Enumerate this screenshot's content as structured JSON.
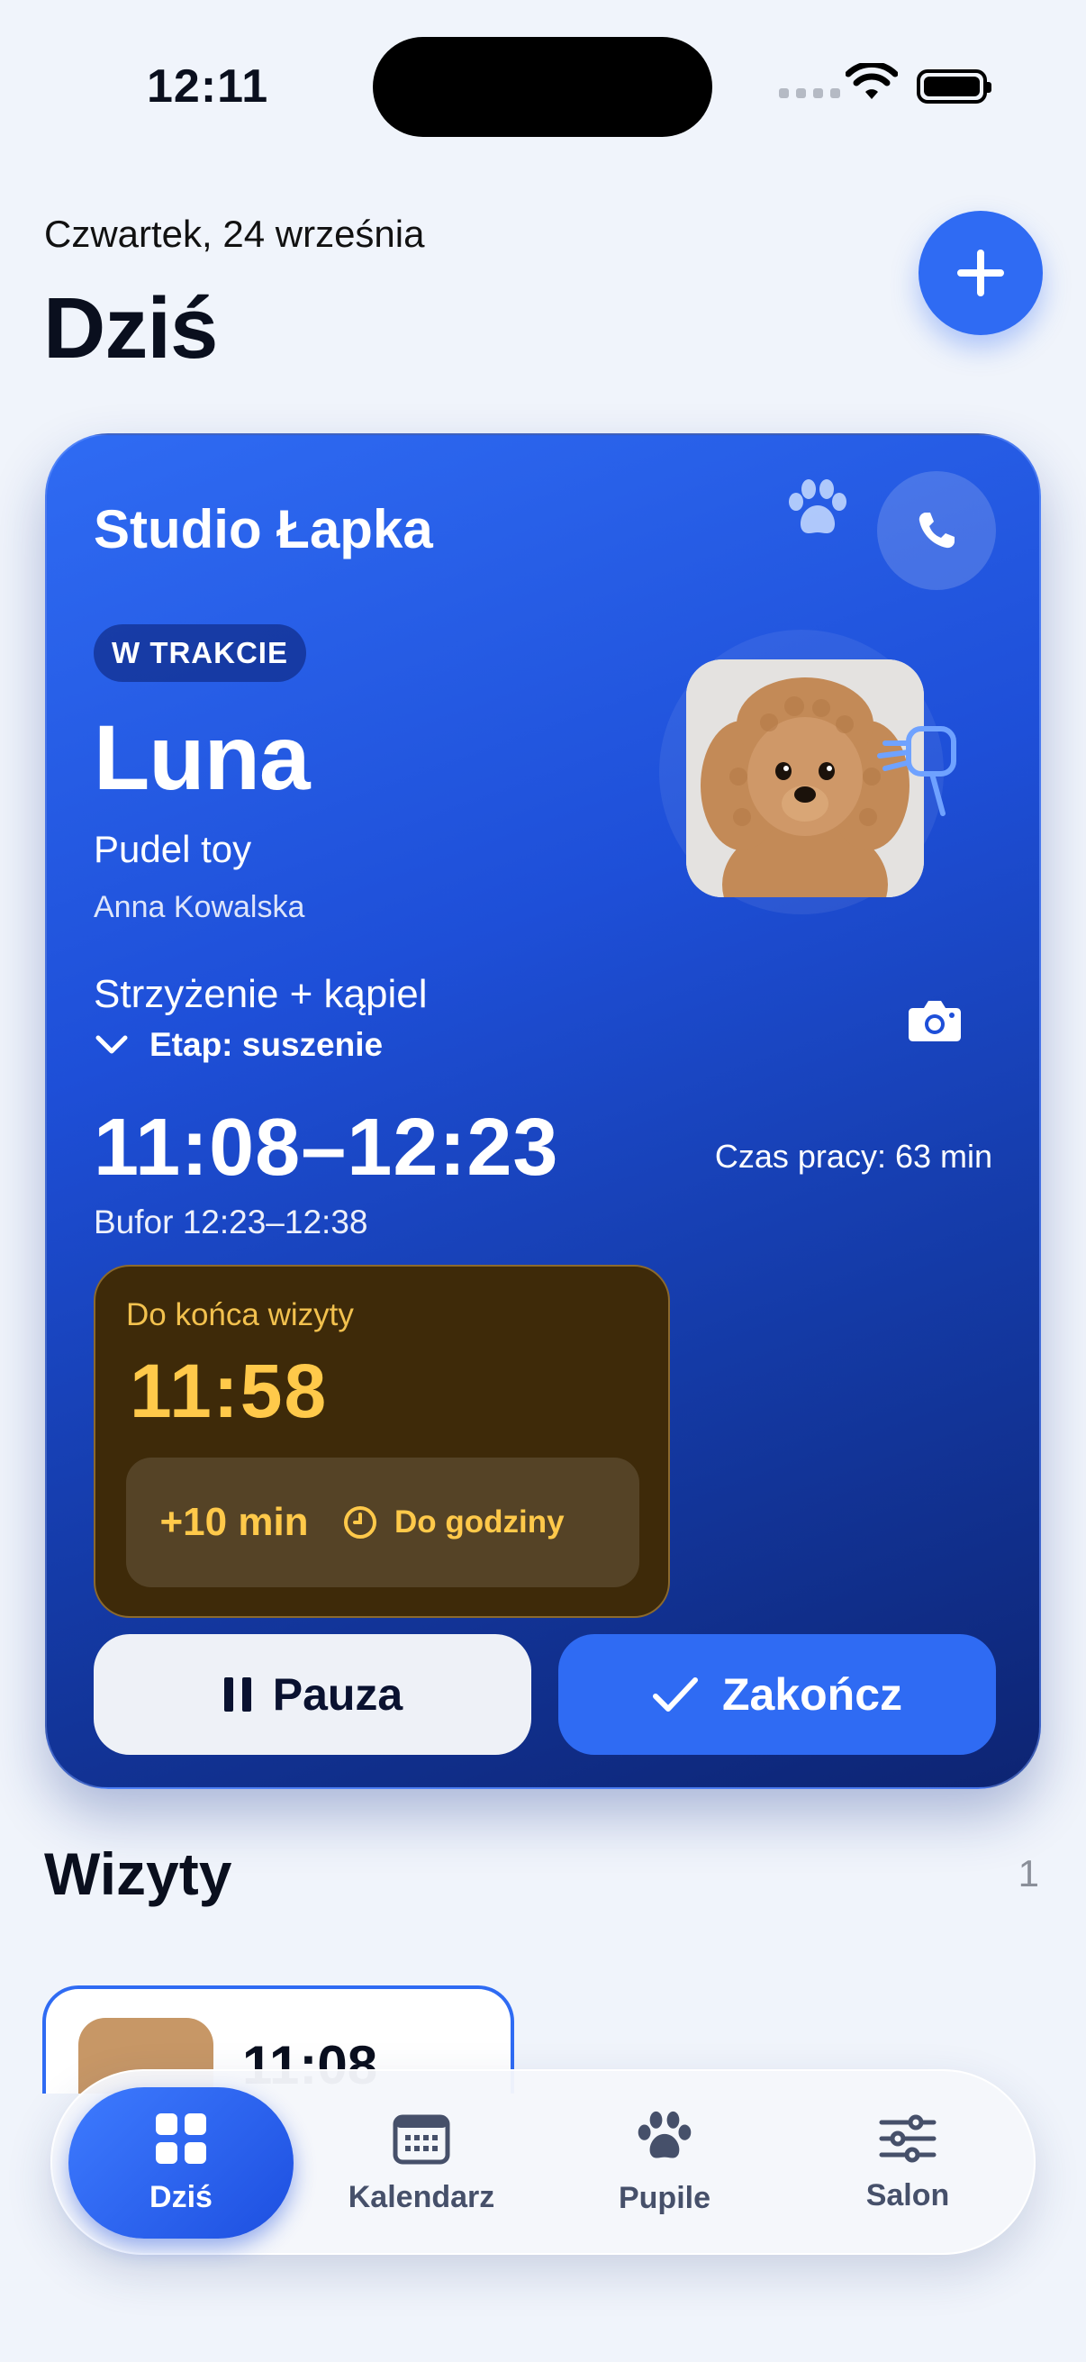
{
  "status_bar": {
    "time": "12:11"
  },
  "header": {
    "date": "Czwartek, 24 września",
    "title": "Dziś",
    "add_button": "plus-icon"
  },
  "current_visit": {
    "salon": "Studio Łapka",
    "status": "W TRAKCIE",
    "pet_name": "Luna",
    "breed": "Pudel toy",
    "owner": "Anna Kowalska",
    "service": "Strzyżenie + kąpiel",
    "stage": "Etap: suszenie",
    "time_range": "11:08–12:23",
    "work_time": "Czas pracy: 63 min",
    "buffer": "Bufor 12:23–12:38",
    "countdown": {
      "label": "Do końca wizyty",
      "time": "11:58",
      "extend": "+10 min",
      "until": "Do godziny"
    },
    "pause_label": "Pauza",
    "finish_label": "Zakończ",
    "accent": "#2F6BF3",
    "countdown_color": "#FFC94A"
  },
  "visits": {
    "title": "Wizyty",
    "count": "1",
    "first_time": "11:08"
  },
  "tabs": [
    {
      "label": "Dziś",
      "icon": "grid-icon",
      "active": true
    },
    {
      "label": "Kalendarz",
      "icon": "calendar-icon"
    },
    {
      "label": "Pupile",
      "icon": "paw-icon"
    },
    {
      "label": "Salon",
      "icon": "sliders-icon"
    }
  ]
}
